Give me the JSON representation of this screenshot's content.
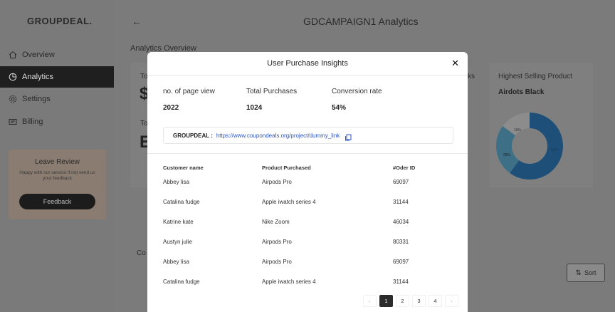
{
  "sidebar": {
    "brand": "GROUPDEAL.",
    "items": [
      {
        "label": "Overview",
        "icon": "home-icon"
      },
      {
        "label": "Analytics",
        "icon": "pie-icon"
      },
      {
        "label": "Settings",
        "icon": "gear-icon"
      },
      {
        "label": "Billing",
        "icon": "billing-icon"
      }
    ],
    "review": {
      "title": "Leave Review",
      "text": "Happy with our service If not send us your feedback",
      "button": "Feedback"
    }
  },
  "main": {
    "back_icon": "←",
    "title": "GDCAMPAIGN1 Analytics",
    "section": "Analytics Overview",
    "peek_card1_label": "To",
    "peek_card1_value": "$",
    "peek_card2_label": "To",
    "peek_card2_value": "E",
    "clicks_peek": "cks",
    "highest_label": "Highest Selling Product",
    "highest_value": "Airdots Black",
    "donut_labels": [
      "15%",
      "25%",
      "60%"
    ],
    "sort_label": "Sort",
    "bottom_peek": "Co"
  },
  "modal": {
    "title": "User Purchase Insights",
    "close": "✕",
    "metrics": [
      {
        "label": "no. of page view",
        "value": "2022"
      },
      {
        "label": "Total Purchases",
        "value": "1024"
      },
      {
        "label": "Conversion rate",
        "value": "54%"
      }
    ],
    "link_label": "GROUPDEAL :",
    "link_url": "https://www.coupondeals.org/project/dummy_link",
    "table": {
      "headers": [
        "Customer name",
        "Product Purchased",
        "#Oder ID"
      ],
      "rows": [
        [
          "Abbey lisa",
          "Airpods Pro",
          "69097"
        ],
        [
          "Catalina fudge",
          "Apple iwatch series 4",
          "31144"
        ],
        [
          "Katrine kate",
          "Nike Zoom",
          "46034"
        ],
        [
          "Austyn julie",
          "Airpods Pro",
          "80331"
        ],
        [
          "Abbey lisa",
          "Airpods Pro",
          "69097"
        ],
        [
          "Catalina fudge",
          "Apple iwatch series 4",
          "31144"
        ]
      ]
    },
    "pagination": {
      "prev": "‹",
      "pages": [
        "1",
        "2",
        "3",
        "4"
      ],
      "active": "1",
      "next": "›"
    }
  },
  "colors": {
    "accent_dark": "#1f1f1f",
    "link": "#2b55c6",
    "donut_dark": "#1e4f78",
    "donut_mid": "#3d6f86",
    "donut_light": "#8c8c8c"
  }
}
